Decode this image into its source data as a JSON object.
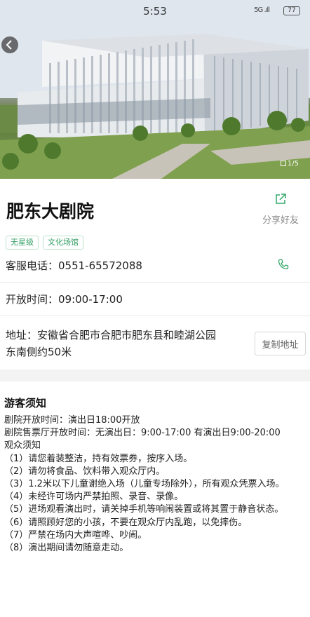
{
  "status_bar": {
    "time": "5:53",
    "signal": "5G .ıll",
    "battery": "77"
  },
  "gallery": {
    "indicator": "1/5"
  },
  "venue": {
    "name": "肥东大剧院",
    "share_label": "分享好友",
    "tags": [
      "无星级",
      "文化场馆"
    ],
    "phone": "客服电话：0551-65572088",
    "hours": "开放时间：09:00-17:00",
    "address_lines": [
      "地址：安徽省合肥市合肥市肥东县和睦湖公园",
      "东南侧约50米"
    ],
    "copy_label": "复制地址"
  },
  "notice": {
    "title": "游客须知",
    "lines": [
      "剧院开放时间：演出日18:00开放",
      "剧院售票厅开放时间：无演出日：9:00-17:00 有演出日9:00-20:00",
      "观众须知",
      "（1）请您着装整洁，持有效票券，按序入场。",
      "（2）请勿将食品、饮料带入观众厅内。",
      "（3）1.2米以下儿童谢绝入场（儿童专场除外），所有观众凭票入场。",
      "（4）未经许可场内严禁拍照、录音、录像。",
      "（5）进场观看演出时，请关掉手机等响闹装置或将其置于静音状态。",
      "（6）请照顾好您的小孩，不要在观众厅内乱跑，以免摔伤。",
      "（7）严禁在场内大声喧哗、吵闹。",
      "（8）演出期间请勿随意走动。"
    ]
  },
  "colors": {
    "accent": "#2f9e62",
    "background": "#f3f3f3"
  }
}
